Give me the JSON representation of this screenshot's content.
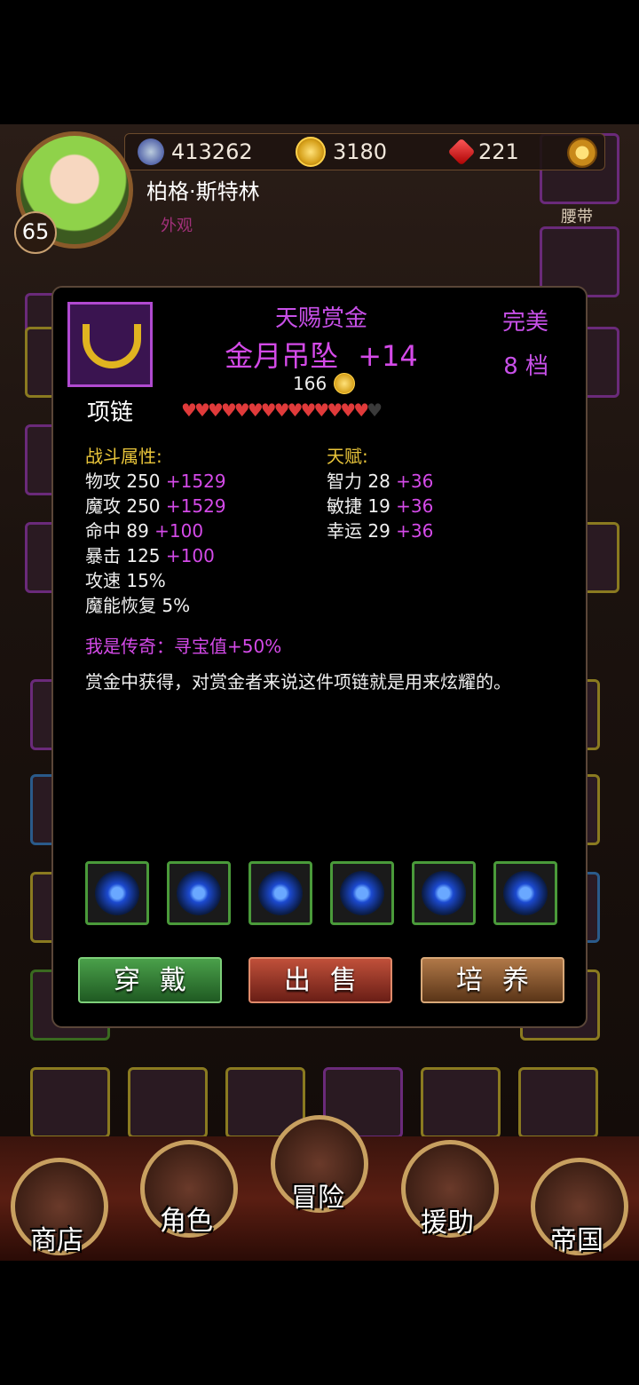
{
  "header": {
    "power": "413262",
    "gold": "3180",
    "gems": "221",
    "icons": [
      "sword-power-icon",
      "gold-coin-icon",
      "red-gem-icon",
      "settings-gear-icon"
    ]
  },
  "hero": {
    "level": "65",
    "name": "柏格·斯特林",
    "appearance_link": "外观"
  },
  "equipment_labels": {
    "belt": "腰带"
  },
  "item": {
    "set_name": "天赐赏金",
    "name": "金月吊坠",
    "enhance": "+14",
    "price": "166",
    "quality": "完美",
    "tier": "8 档",
    "type": "项链",
    "hearts_filled": 14,
    "hearts_total": 15,
    "combat_header": "战斗属性:",
    "combat_stats": [
      {
        "label": "物攻 250",
        "bonus": "+1529"
      },
      {
        "label": "魔攻 250",
        "bonus": "+1529"
      },
      {
        "label": "命中 89",
        "bonus": "+100"
      },
      {
        "label": "暴击 125",
        "bonus": "+100"
      },
      {
        "label": "攻速 15%",
        "bonus": ""
      },
      {
        "label": "魔能恢复 5%",
        "bonus": ""
      }
    ],
    "talent_header": "天赋:",
    "talents": [
      {
        "label": "智力 28",
        "bonus": "+36"
      },
      {
        "label": "敏捷 19",
        "bonus": "+36"
      },
      {
        "label": "幸运 29",
        "bonus": "+36"
      }
    ],
    "legend_effect": "我是传奇：寻宝值+50%",
    "description": "赏金中获得，对赏金者来说这件项链就是用来炫耀的。",
    "sockets": [
      "blue-gem-icon",
      "blue-gem-icon",
      "blue-gem-icon",
      "blue-gem-icon",
      "blue-gem-icon",
      "blue-gem-icon"
    ]
  },
  "actions": {
    "equip": "穿戴",
    "sell": "出售",
    "train": "培养"
  },
  "nav": {
    "shop": "商店",
    "character": "角色",
    "adventure": "冒险",
    "support": "援助",
    "empire": "帝国"
  }
}
